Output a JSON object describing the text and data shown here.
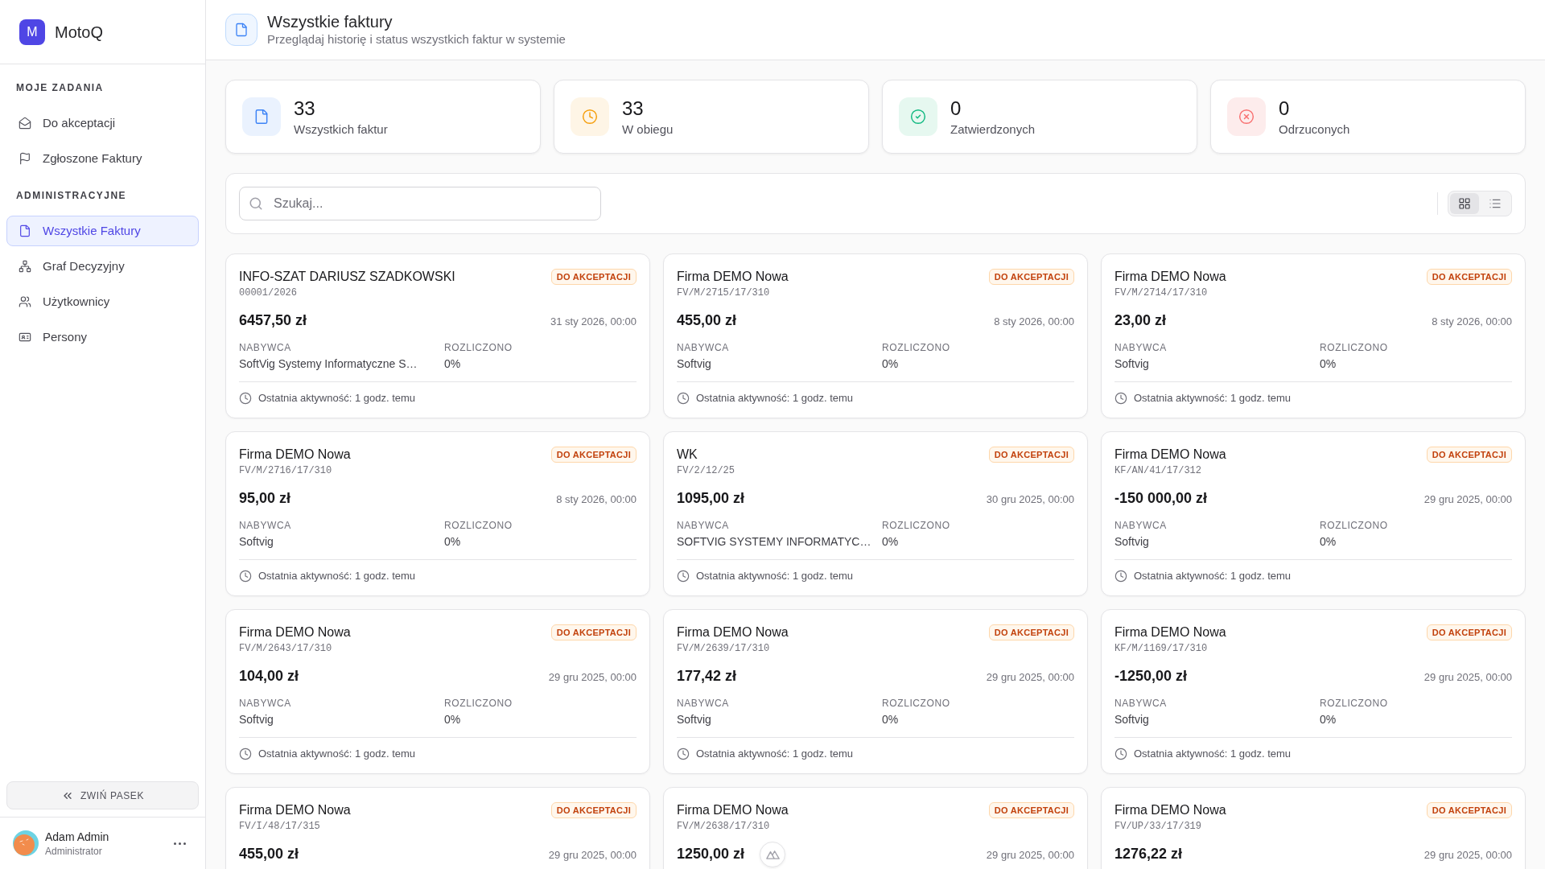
{
  "sidebar": {
    "logo_letter": "M",
    "app_name": "MotoQ",
    "sections": [
      {
        "title": "MOJE ZADANIA",
        "items": [
          {
            "kind": "inbox",
            "label": "Do akceptacji",
            "selected": false
          },
          {
            "kind": "flag",
            "label": "Zgłoszone Faktury",
            "selected": false
          }
        ]
      },
      {
        "title": "ADMINISTRACYJNE",
        "items": [
          {
            "kind": "file",
            "label": "Wszystkie Faktury",
            "selected": true
          },
          {
            "kind": "network",
            "label": "Graf Decyzyjny",
            "selected": false
          },
          {
            "kind": "users",
            "label": "Użytkownicy",
            "selected": false
          },
          {
            "kind": "id_card",
            "label": "Persony",
            "selected": false
          }
        ]
      }
    ],
    "collapse_button": "ZWIŃ PASEK",
    "user": {
      "name": "Adam Admin",
      "role": "Administrator"
    }
  },
  "header": {
    "title": "Wszystkie faktury",
    "subtitle": "Przeglądaj historię i status wszystkich faktur w systemie"
  },
  "stats": [
    {
      "kind": "total",
      "value": "33",
      "label": "Wszystkich faktur"
    },
    {
      "kind": "pending",
      "value": "33",
      "label": "W obiegu"
    },
    {
      "kind": "approved",
      "value": "0",
      "label": "Zatwierdzonych"
    },
    {
      "kind": "rejected",
      "value": "0",
      "label": "Odrzuconych"
    }
  ],
  "search": {
    "placeholder": "Szukaj..."
  },
  "view_toggle": [
    {
      "kind": "grid",
      "selected": true
    },
    {
      "kind": "list",
      "selected": false
    }
  ],
  "invoices": [
    {
      "company": "INFO-SZAT DARIUSZ SZADKOWSKI",
      "number": "00001/2026",
      "status": "DO AKCEPTACJI",
      "amount": "6457,50 zł",
      "date": "31 sty 2026, 00:00",
      "fields": [
        {
          "label": "NABYWCA",
          "value": "SoftVig Systemy Informatyczne S…"
        },
        {
          "label": "ROZLICZONO",
          "value": "0%"
        }
      ],
      "activity": "Ostatnia aktywność: 1 godz. temu"
    },
    {
      "company": "Firma DEMO Nowa",
      "number": "FV/M/2715/17/310",
      "status": "DO AKCEPTACJI",
      "amount": "455,00 zł",
      "date": "8 sty 2026, 00:00",
      "fields": [
        {
          "label": "NABYWCA",
          "value": "Softvig"
        },
        {
          "label": "ROZLICZONO",
          "value": "0%"
        }
      ],
      "activity": "Ostatnia aktywność: 1 godz. temu"
    },
    {
      "company": "Firma DEMO Nowa",
      "number": "FV/M/2714/17/310",
      "status": "DO AKCEPTACJI",
      "amount": "23,00 zł",
      "date": "8 sty 2026, 00:00",
      "fields": [
        {
          "label": "NABYWCA",
          "value": "Softvig"
        },
        {
          "label": "ROZLICZONO",
          "value": "0%"
        }
      ],
      "activity": "Ostatnia aktywność: 1 godz. temu"
    },
    {
      "company": "Firma DEMO Nowa",
      "number": "FV/M/2716/17/310",
      "status": "DO AKCEPTACJI",
      "amount": "95,00 zł",
      "date": "8 sty 2026, 00:00",
      "fields": [
        {
          "label": "NABYWCA",
          "value": "Softvig"
        },
        {
          "label": "ROZLICZONO",
          "value": "0%"
        }
      ],
      "activity": "Ostatnia aktywność: 1 godz. temu"
    },
    {
      "company": "WK",
      "number": "FV/2/12/25",
      "status": "DO AKCEPTACJI",
      "amount": "1095,00 zł",
      "date": "30 gru 2025, 00:00",
      "fields": [
        {
          "label": "NABYWCA",
          "value": "SOFTVIG SYSTEMY INFORMATYC…"
        },
        {
          "label": "ROZLICZONO",
          "value": "0%"
        }
      ],
      "activity": "Ostatnia aktywność: 1 godz. temu"
    },
    {
      "company": "Firma DEMO Nowa",
      "number": "KF/AN/41/17/312",
      "status": "DO AKCEPTACJI",
      "amount": "-150 000,00 zł",
      "date": "29 gru 2025, 00:00",
      "fields": [
        {
          "label": "NABYWCA",
          "value": "Softvig"
        },
        {
          "label": "ROZLICZONO",
          "value": "0%"
        }
      ],
      "activity": "Ostatnia aktywność: 1 godz. temu"
    },
    {
      "company": "Firma DEMO Nowa",
      "number": "FV/M/2643/17/310",
      "status": "DO AKCEPTACJI",
      "amount": "104,00 zł",
      "date": "29 gru 2025, 00:00",
      "fields": [
        {
          "label": "NABYWCA",
          "value": "Softvig"
        },
        {
          "label": "ROZLICZONO",
          "value": "0%"
        }
      ],
      "activity": "Ostatnia aktywność: 1 godz. temu"
    },
    {
      "company": "Firma DEMO Nowa",
      "number": "FV/M/2639/17/310",
      "status": "DO AKCEPTACJI",
      "amount": "177,42 zł",
      "date": "29 gru 2025, 00:00",
      "fields": [
        {
          "label": "NABYWCA",
          "value": "Softvig"
        },
        {
          "label": "ROZLICZONO",
          "value": "0%"
        }
      ],
      "activity": "Ostatnia aktywność: 1 godz. temu"
    },
    {
      "company": "Firma DEMO Nowa",
      "number": "KF/M/1169/17/310",
      "status": "DO AKCEPTACJI",
      "amount": "-1250,00 zł",
      "date": "29 gru 2025, 00:00",
      "fields": [
        {
          "label": "NABYWCA",
          "value": "Softvig"
        },
        {
          "label": "ROZLICZONO",
          "value": "0%"
        }
      ],
      "activity": "Ostatnia aktywność: 1 godz. temu"
    },
    {
      "company": "Firma DEMO Nowa",
      "number": "FV/I/48/17/315",
      "status": "DO AKCEPTACJI",
      "amount": "455,00 zł",
      "date": "29 gru 2025, 00:00"
    },
    {
      "company": "Firma DEMO Nowa",
      "number": "FV/M/2638/17/310",
      "status": "DO AKCEPTACJI",
      "amount": "1250,00 zł",
      "date": "29 gru 2025, 00:00"
    },
    {
      "company": "Firma DEMO Nowa",
      "number": "FV/UP/33/17/319",
      "status": "DO AKCEPTACJI",
      "amount": "1276,22 zł",
      "date": "29 gru 2025, 00:00"
    }
  ]
}
